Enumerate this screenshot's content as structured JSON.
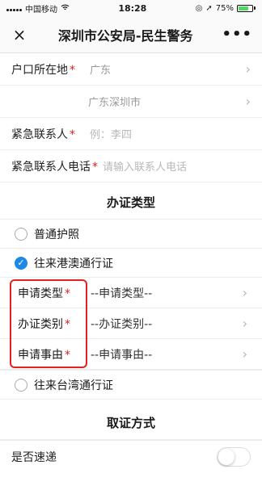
{
  "status_bar": {
    "carrier": "中国移动",
    "time": "18:28",
    "battery_pct": "75%"
  },
  "nav": {
    "title": "深圳市公安局-民生警务",
    "close_icon": "×",
    "more_icon": "•••"
  },
  "form": {
    "hukou_label": "户口所在地",
    "hukou_province": "广东",
    "hukou_city": "广东深圳市",
    "contact_label": "紧急联系人",
    "contact_placeholder": "例：李四",
    "phone_label": "紧急联系人电话",
    "phone_placeholder": "请输入联系人电话"
  },
  "section1": {
    "title": "办证类型"
  },
  "options": {
    "passport": "普通护照",
    "hk_macau": "往来港澳通行证",
    "taiwan": "往来台湾通行证"
  },
  "sub_fields": [
    {
      "label": "申请类型",
      "value": "--申请类型--"
    },
    {
      "label": "办证类别",
      "value": "--办证类别--"
    },
    {
      "label": "申请事由",
      "value": "--申请事由--"
    }
  ],
  "section2": {
    "title": "取证方式"
  },
  "express": {
    "label": "是否速递"
  }
}
